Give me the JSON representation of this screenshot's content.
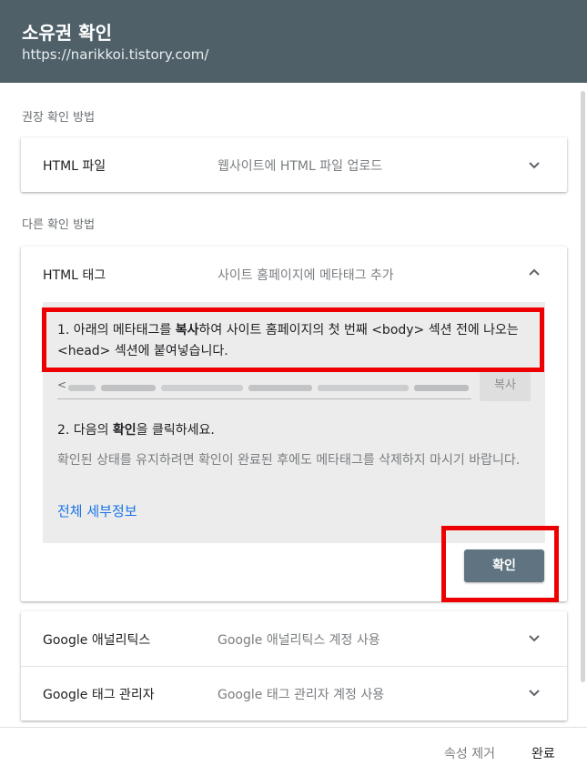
{
  "header": {
    "title": "소유권 확인",
    "url": "https://narikkoi.tistory.com/"
  },
  "recommended": {
    "label": "권장 확인 방법",
    "html_file": {
      "title": "HTML 파일",
      "description": "웹사이트에 HTML 파일 업로드"
    }
  },
  "other": {
    "label": "다른 확인 방법",
    "html_tag": {
      "title": "HTML 태그",
      "description": "사이트 홈페이지에 메타태그 추가",
      "step1_prefix": "1. 아래의 메타태그를 ",
      "step1_bold": "복사",
      "step1_suffix": "하여 사이트 홈페이지의 첫 번째 <body> 섹션 전에 나오는 <head> 섹션에 붙여넣습니다.",
      "meta_prefix": "<",
      "copy_label": "복사",
      "step2_prefix": "2. 다음의 ",
      "step2_bold": "확인",
      "step2_suffix": "을 클릭하세요.",
      "note": "확인된 상태를 유지하려면 확인이 완료된 후에도 메타태그를 삭제하지 마시기 바랍니다.",
      "details_link": "전체 세부정보",
      "confirm_label": "확인"
    },
    "google_analytics": {
      "title": "Google 애널리틱스",
      "description": "Google 애널리틱스 계정 사용"
    },
    "google_tag_manager": {
      "title": "Google 태그 관리자",
      "description": "Google 태그 관리자 계정 사용"
    }
  },
  "footer": {
    "remove_label": "속성 제거",
    "done_label": "완료"
  },
  "colors": {
    "header_bg": "#4f6068",
    "accent_link": "#1a73e8",
    "confirm_button": "#5f7480",
    "highlight_box": "#ee0000"
  },
  "icons": {
    "expand": "chevron-down-icon",
    "collapse": "chevron-up-icon"
  }
}
